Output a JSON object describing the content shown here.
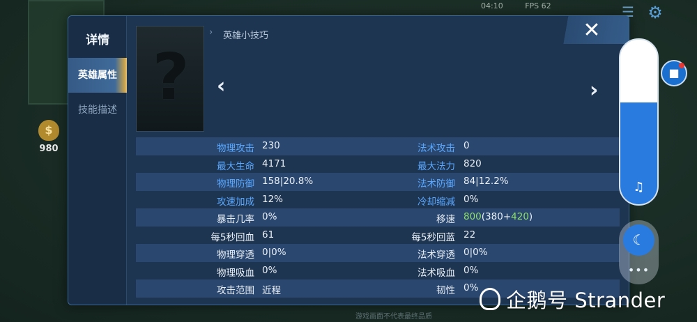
{
  "hud": {
    "time": "04:10",
    "fps": "FPS 62",
    "money": "980"
  },
  "panel": {
    "title": "详情",
    "tabs": [
      {
        "label": "英雄属性",
        "active": true
      },
      {
        "label": "技能描述",
        "active": false
      }
    ],
    "close_icon": "close-icon",
    "tips_title": "英雄小技巧",
    "portrait_placeholder": "?"
  },
  "stats": {
    "rows": [
      {
        "l_label": "物理攻击",
        "l_value": "230",
        "r_label": "法术攻击",
        "r_value": "0",
        "l_color": "blue",
        "r_color": "blue"
      },
      {
        "l_label": "最大生命",
        "l_value": "4171",
        "r_label": "最大法力",
        "r_value": "820",
        "l_color": "blue",
        "r_color": "blue"
      },
      {
        "l_label": "物理防御",
        "l_value": "158|20.8%",
        "r_label": "法术防御",
        "r_value": "84|12.2%",
        "l_color": "blue",
        "r_color": "blue"
      },
      {
        "l_label": "攻速加成",
        "l_value": "12%",
        "r_label": "冷却缩减",
        "r_value": "0%",
        "l_color": "blue",
        "r_color": "blue"
      },
      {
        "l_label": "暴击几率",
        "l_value": "0%",
        "r_label": "移速",
        "r_value_parts": [
          "800",
          "(380+",
          "420",
          ")"
        ],
        "l_color": "white",
        "r_color": "white"
      },
      {
        "l_label": "每5秒回血",
        "l_value": "61",
        "r_label": "每5秒回蓝",
        "r_value": "22",
        "l_color": "white",
        "r_color": "white"
      },
      {
        "l_label": "物理穿透",
        "l_value": "0|0%",
        "r_label": "法术穿透",
        "r_value": "0|0%",
        "l_color": "white",
        "r_color": "white"
      },
      {
        "l_label": "物理吸血",
        "l_value": "0%",
        "r_label": "法术吸血",
        "r_value": "0%",
        "l_color": "white",
        "r_color": "white"
      },
      {
        "l_label": "攻击范围",
        "l_value": "近程",
        "r_label": "韧性",
        "r_value": "0%",
        "l_color": "white",
        "r_color": "white"
      }
    ]
  },
  "side": {
    "music_level": 0.62,
    "music_icon": "music-note-icon",
    "moon_icon": "moon-icon",
    "more": "•••",
    "record_icon": "video-record-icon"
  },
  "watermark": {
    "text": "企鹅号 Strander"
  },
  "bottom_hint": "游戏画面不代表最终品质",
  "colors": {
    "accent_blue": "#5aa8ff",
    "value_green": "#8fe06a",
    "tab_gold": "#e6c070",
    "panel_bg": "#1e3552"
  }
}
